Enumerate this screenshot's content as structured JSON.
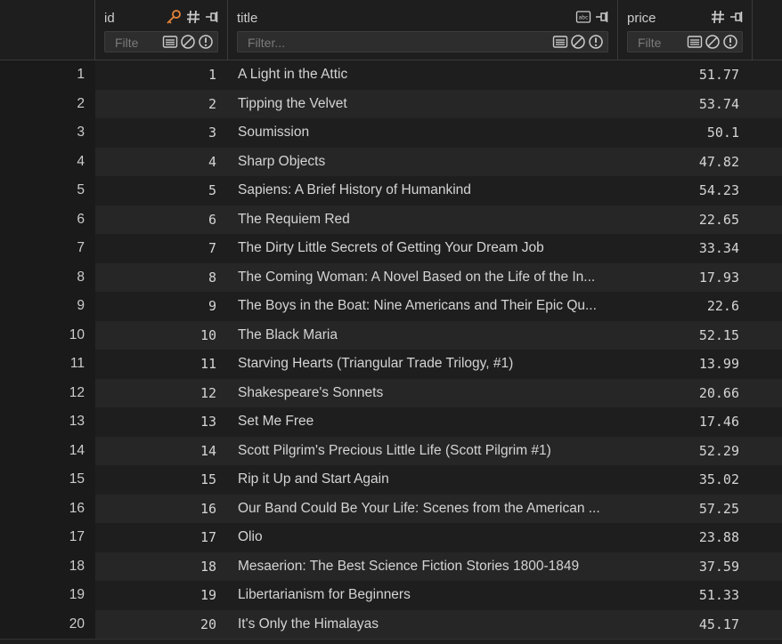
{
  "colors": {
    "background": "#1e1e1e",
    "row_alt": "#262626",
    "key_icon": "#e8863b",
    "text": "#d4d4d4"
  },
  "columns": {
    "id": {
      "name": "id",
      "filter_placeholder": "Filte",
      "icons": [
        "key-icon",
        "number-type-icon",
        "pin-icon"
      ]
    },
    "title": {
      "name": "title",
      "filter_placeholder": "Filter...",
      "icons": [
        "text-type-icon",
        "pin-icon"
      ]
    },
    "price": {
      "name": "price",
      "filter_placeholder": "Filte",
      "icons": [
        "number-type-icon",
        "pin-icon"
      ]
    }
  },
  "rows": [
    {
      "rownum": "1",
      "id": "1",
      "title": "A Light in the Attic",
      "price": "51.77"
    },
    {
      "rownum": "2",
      "id": "2",
      "title": "Tipping the Velvet",
      "price": "53.74"
    },
    {
      "rownum": "3",
      "id": "3",
      "title": "Soumission",
      "price": "50.1"
    },
    {
      "rownum": "4",
      "id": "4",
      "title": "Sharp Objects",
      "price": "47.82"
    },
    {
      "rownum": "5",
      "id": "5",
      "title": "Sapiens: A Brief History of Humankind",
      "price": "54.23"
    },
    {
      "rownum": "6",
      "id": "6",
      "title": "The Requiem Red",
      "price": "22.65"
    },
    {
      "rownum": "7",
      "id": "7",
      "title": "The Dirty Little Secrets of Getting Your Dream Job",
      "price": "33.34"
    },
    {
      "rownum": "8",
      "id": "8",
      "title": "The Coming Woman: A Novel Based on the Life of the In...",
      "price": "17.93"
    },
    {
      "rownum": "9",
      "id": "9",
      "title": "The Boys in the Boat: Nine Americans and Their Epic Qu...",
      "price": "22.6"
    },
    {
      "rownum": "10",
      "id": "10",
      "title": "The Black Maria",
      "price": "52.15"
    },
    {
      "rownum": "11",
      "id": "11",
      "title": "Starving Hearts (Triangular Trade Trilogy, #1)",
      "price": "13.99"
    },
    {
      "rownum": "12",
      "id": "12",
      "title": "Shakespeare's Sonnets",
      "price": "20.66"
    },
    {
      "rownum": "13",
      "id": "13",
      "title": "Set Me Free",
      "price": "17.46"
    },
    {
      "rownum": "14",
      "id": "14",
      "title": "Scott Pilgrim's Precious Little Life (Scott Pilgrim #1)",
      "price": "52.29"
    },
    {
      "rownum": "15",
      "id": "15",
      "title": "Rip it Up and Start Again",
      "price": "35.02"
    },
    {
      "rownum": "16",
      "id": "16",
      "title": "Our Band Could Be Your Life: Scenes from the American ...",
      "price": "57.25"
    },
    {
      "rownum": "17",
      "id": "17",
      "title": "Olio",
      "price": "23.88"
    },
    {
      "rownum": "18",
      "id": "18",
      "title": "Mesaerion: The Best Science Fiction Stories 1800-1849",
      "price": "37.59"
    },
    {
      "rownum": "19",
      "id": "19",
      "title": "Libertarianism for Beginners",
      "price": "51.33"
    },
    {
      "rownum": "20",
      "id": "20",
      "title": "It's Only the Himalayas",
      "price": "45.17"
    }
  ]
}
